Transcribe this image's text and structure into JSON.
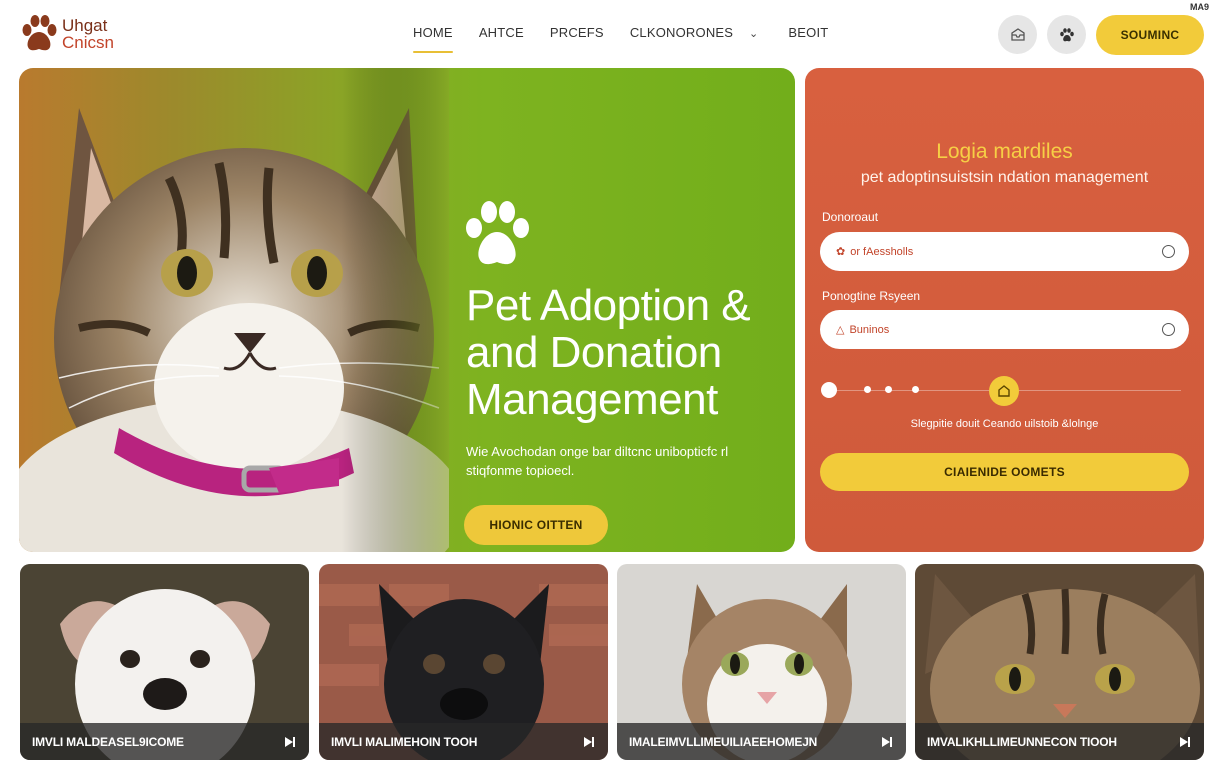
{
  "brand": {
    "line1": "Uhgat",
    "line2": "Cnicsn",
    "corner_tag": "MA9"
  },
  "nav": {
    "items": [
      {
        "label": "HOME",
        "active": true
      },
      {
        "label": "AHTCE",
        "active": false
      },
      {
        "label": "PRCEFS",
        "active": false
      },
      {
        "label": "CLKONORONES",
        "active": false
      }
    ],
    "extra_label": "BEOIT"
  },
  "header": {
    "inbox_icon": "inbox-icon",
    "paw_icon": "paw-icon",
    "cta_label": "SOUMINC"
  },
  "hero": {
    "title_lines": [
      "Pet Adoption &",
      "and Donation",
      "Management"
    ],
    "subtitle": "Wie Avochodan onge bar diltcnc unibopticfc rl stiqfonme topioecl.",
    "button_label": "HIONIC OITTEN"
  },
  "panel": {
    "title": "Logia mardiles",
    "subtitle": "pet adoptinsuistsin ndation management",
    "field1": {
      "label": "Donoroaut",
      "value": "or fAessholls"
    },
    "field2": {
      "label": "Ponogtine Rsyeen",
      "value": "Buninos"
    },
    "note": "Slegpitie douit Ceando uilstoib &lolnge",
    "button_label": "CIAIENIDE OOMETS"
  },
  "cards": [
    {
      "label": "IMVLI MALDEASEL9ICOME"
    },
    {
      "label": "IMVLI MALIMEHOIN TOOH"
    },
    {
      "label": "IMALEIMVLLIMEUILIAEEHOMEJN"
    },
    {
      "label": "IMVALIKHLLIMEUNNECON TIOOH"
    }
  ],
  "colors": {
    "accent": "#f2cb3a",
    "panel": "#d25c3c",
    "hero_green": "#7eb320",
    "brand": "#7a3019"
  }
}
